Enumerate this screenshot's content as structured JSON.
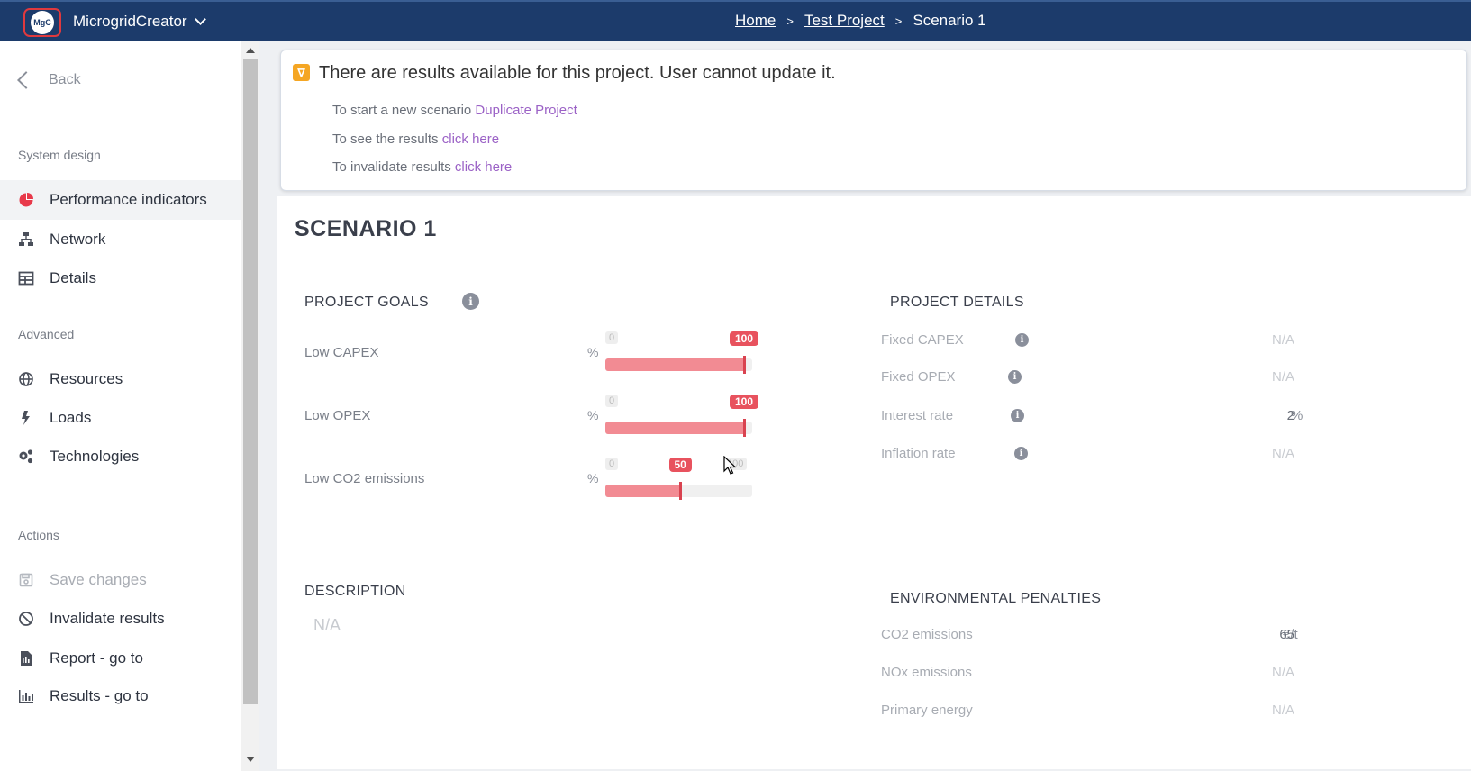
{
  "topbar": {
    "logo_text": "MgC",
    "app_name": "MicrogridCreator",
    "breadcrumb": {
      "home": "Home",
      "project": "Test Project",
      "scenario": "Scenario 1",
      "separator": ">"
    }
  },
  "sidebar": {
    "back_label": "Back",
    "sections": {
      "system_design": "System design",
      "advanced": "Advanced",
      "actions": "Actions"
    },
    "items": [
      {
        "label": "Performance indicators",
        "icon": "pie-chart-icon"
      },
      {
        "label": "Network",
        "icon": "network-icon"
      },
      {
        "label": "Details",
        "icon": "table-icon"
      },
      {
        "label": "Resources",
        "icon": "globe-icon"
      },
      {
        "label": "Loads",
        "icon": "bolt-icon"
      },
      {
        "label": "Technologies",
        "icon": "gears-icon"
      },
      {
        "label": "Save changes",
        "icon": "save-icon"
      },
      {
        "label": "Invalidate results",
        "icon": "ban-icon"
      },
      {
        "label": "Report - go to",
        "icon": "report-icon"
      },
      {
        "label": "Results - go to",
        "icon": "bar-chart-icon"
      }
    ]
  },
  "alert": {
    "icon_glyph": "∇",
    "title": "There are results available for this project. User cannot update it.",
    "line1_text": "To start a new scenario ",
    "line1_link": "Duplicate Project",
    "line2_text": "To see the results ",
    "line2_link": "click here",
    "line3_text": "To invalidate results ",
    "line3_link": "click here"
  },
  "main": {
    "title": "SCENARIO 1",
    "project_goals": {
      "heading": "PROJECT GOALS",
      "goals": [
        {
          "label": "Low CAPEX",
          "unit": "%",
          "min": "0",
          "max": "100",
          "value": 100,
          "value_label": "100"
        },
        {
          "label": "Low OPEX",
          "unit": "%",
          "min": "0",
          "max": "100",
          "value": 100,
          "value_label": "100"
        },
        {
          "label": "Low CO2 emissions",
          "unit": "%",
          "min": "0",
          "max": "100",
          "value": 50,
          "value_label": "50"
        }
      ]
    },
    "project_details": {
      "heading": "PROJECT DETAILS",
      "rows": [
        {
          "label": "Fixed CAPEX",
          "unit": "",
          "value": "N/A"
        },
        {
          "label": "Fixed OPEX",
          "unit": "",
          "value": "N/A"
        },
        {
          "label": "Interest rate",
          "unit": "%",
          "value": "2"
        },
        {
          "label": "Inflation rate",
          "unit": "",
          "value": "N/A"
        }
      ]
    },
    "description": {
      "heading": "DESCRIPTION",
      "value": "N/A"
    },
    "environmental_penalties": {
      "heading": "ENVIRONMENTAL PENALTIES",
      "rows": [
        {
          "label": "CO2 emissions",
          "unit": "€/t",
          "value": "65"
        },
        {
          "label": "NOx emissions",
          "unit": "",
          "value": "N/A"
        },
        {
          "label": "Primary energy",
          "unit": "",
          "value": "N/A"
        }
      ]
    }
  },
  "colors": {
    "topbar": "#1c3b6b",
    "slider_fill": "#f28b93",
    "slider_value": "#e8525e",
    "link": "#9b62c6",
    "warning": "#f5a623"
  }
}
